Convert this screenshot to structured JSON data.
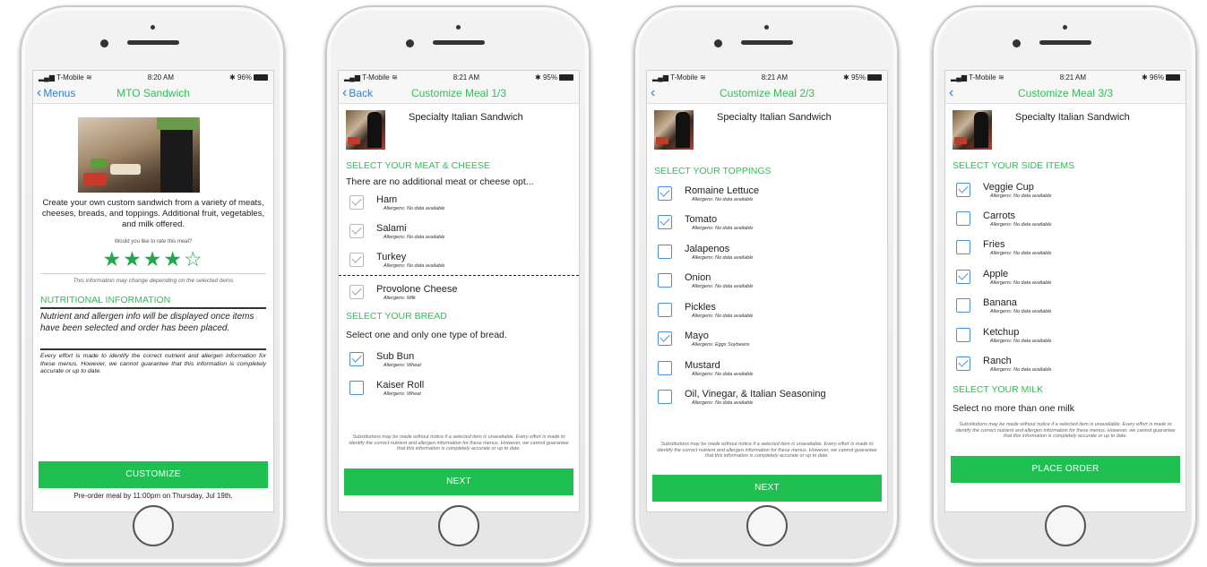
{
  "status": {
    "carrier": "T-Mobile",
    "screens": [
      {
        "time": "8:20 AM",
        "battery": "96%"
      },
      {
        "time": "8:21 AM",
        "battery": "95%"
      },
      {
        "time": "8:21 AM",
        "battery": "95%"
      },
      {
        "time": "8:21 AM",
        "battery": "96%"
      }
    ]
  },
  "screen1": {
    "back_label": "Menus",
    "title": "MTO Sandwich",
    "description": "Create your own custom sandwich from a variety of meats, cheeses, breads, and toppings. Additional fruit, vegetables, and milk offered.",
    "rate_prompt": "Would you like to rate this meal?",
    "rating": 4,
    "rating_max": 5,
    "stars": [
      "★",
      "★",
      "★",
      "★",
      "☆"
    ],
    "info_change": "This information may change depending on the selected items",
    "nutrition_heading": "NUTRITIONAL INFORMATION",
    "nutrition_text": "Nutrient and allergen info will be displayed once items have been selected and order has been placed.",
    "disclaimer": "Every effort is made to identify the correct nutrient and allergen information for these menus. However, we cannot guarantee that this information is completely accurate or up to date.",
    "button": "CUSTOMIZE",
    "preorder": "Pre-order meal by 11:00pm on Thursday, Jul 19th."
  },
  "screen2": {
    "back_label": "Back",
    "title": "Customize Meal 1/3",
    "meal_name": "Specialty Italian Sandwich",
    "meat_heading": "SELECT YOUR MEAT & CHEESE",
    "meat_note": "There are no additional meat or cheese opt...",
    "meat_items": [
      {
        "name": "Ham",
        "allergens": "Allergens: No data available"
      },
      {
        "name": "Salami",
        "allergens": "Allergens: No data available"
      },
      {
        "name": "Turkey",
        "allergens": "Allergens: No data available"
      },
      {
        "name": "Provolone Cheese",
        "allergens": "Allergens: Milk"
      }
    ],
    "bread_heading": "SELECT YOUR BREAD",
    "bread_note": "Select one and only one type of bread.",
    "bread_items": [
      {
        "name": "Sub Bun",
        "allergens": "Allergens: Wheat",
        "checked": true
      },
      {
        "name": "Kaiser Roll",
        "allergens": "Allergens: Wheat",
        "checked": false
      }
    ],
    "footnote": "Substitutions may be made without notice if a selected item is unavailable. Every effort is made to identify the correct nutrient and allergen information for these menus. However, we cannot guarantee that this information is completely accurate or up to date.",
    "button": "NEXT"
  },
  "screen3": {
    "title": "Customize Meal 2/3",
    "meal_name": "Specialty Italian Sandwich",
    "heading": "SELECT YOUR TOPPINGS",
    "items": [
      {
        "name": "Romaine Lettuce",
        "allergens": "Allergens: No data available",
        "checked": true
      },
      {
        "name": "Tomato",
        "allergens": "Allergens: No data available",
        "checked": true
      },
      {
        "name": "Jalapenos",
        "allergens": "Allergens: No data available",
        "checked": false
      },
      {
        "name": "Onion",
        "allergens": "Allergens: No data available",
        "checked": false
      },
      {
        "name": "Pickles",
        "allergens": "Allergens: No data available",
        "checked": false
      },
      {
        "name": "Mayo",
        "allergens": "Allergens: Eggs Soybeans",
        "checked": true
      },
      {
        "name": "Mustard",
        "allergens": "Allergens: No data available",
        "checked": false
      },
      {
        "name": "Oil, Vinegar, & Italian Seasoning",
        "allergens": "Allergens: No data available",
        "checked": false
      }
    ],
    "footnote": "Substitutions may be made without notice if a selected item is unavailable. Every effort is made to identify the correct nutrient and allergen information for these menus. However, we cannot guarantee that this information is completely accurate or up to date.",
    "button": "NEXT"
  },
  "screen4": {
    "title": "Customize Meal 3/3",
    "meal_name": "Specialty Italian Sandwich",
    "heading": "SELECT YOUR SIDE ITEMS",
    "items": [
      {
        "name": "Veggie Cup",
        "allergens": "Allergens: No data available",
        "checked": true
      },
      {
        "name": "Carrots",
        "allergens": "Allergens: No data available",
        "checked": false
      },
      {
        "name": "Fries",
        "allergens": "Allergens: No data available",
        "checked": false
      },
      {
        "name": "Apple",
        "allergens": "Allergens: No data available",
        "checked": true
      },
      {
        "name": "Banana",
        "allergens": "Allergens: No data available",
        "checked": false
      },
      {
        "name": "Ketchup",
        "allergens": "Allergens: No data available",
        "checked": false
      },
      {
        "name": "Ranch",
        "allergens": "Allergens: No data available",
        "checked": true
      }
    ],
    "milk_heading": "SELECT YOUR MILK",
    "milk_note": "Select no more than one milk",
    "footnote": "Substitutions may be made without notice if a selected item is unavailable. Every effort is made to identify the correct nutrient and allergen information for these menus. However, we cannot guarantee that this information is completely accurate or up to date.",
    "button": "PLACE ORDER"
  },
  "colors": {
    "accent_green": "#2ec057",
    "button_green": "#1fbf52",
    "link_blue": "#2a7fe0",
    "checkbox_blue": "#4a90d9"
  }
}
